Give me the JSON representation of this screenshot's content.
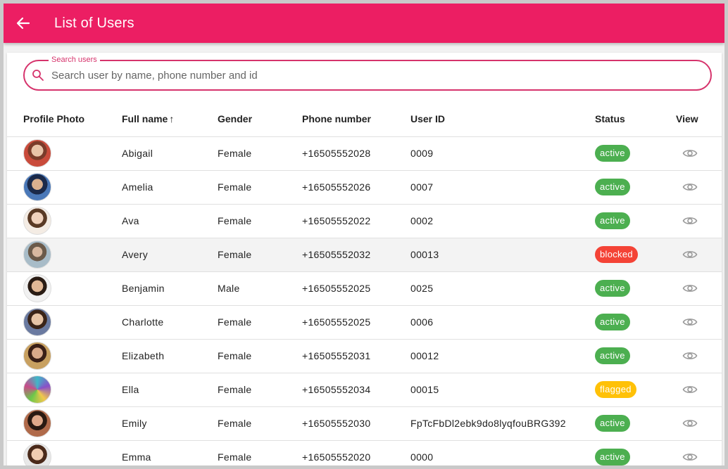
{
  "appbar": {
    "title": "List of Users",
    "back_icon": "arrow-left-icon",
    "color": "#ec1e63"
  },
  "search": {
    "label": "Search users",
    "placeholder": "Search user by name, phone number and id",
    "value": "",
    "icon": "search-icon"
  },
  "table": {
    "columns": [
      "Profile Photo",
      "Full name",
      "Gender",
      "Phone number",
      "User ID",
      "Status",
      "View"
    ],
    "sort": {
      "column": "Full name",
      "direction": "ascending",
      "icon": "arrow-up-icon"
    },
    "rows": [
      {
        "name": "Abigail",
        "gender": "Female",
        "phone": "+16505552028",
        "id": "0009",
        "status": "active"
      },
      {
        "name": "Amelia",
        "gender": "Female",
        "phone": "+16505552026",
        "id": "0007",
        "status": "active"
      },
      {
        "name": "Ava",
        "gender": "Female",
        "phone": "+16505552022",
        "id": "0002",
        "status": "active"
      },
      {
        "name": "Avery",
        "gender": "Female",
        "phone": "+16505552032",
        "id": "00013",
        "status": "blocked"
      },
      {
        "name": "Benjamin",
        "gender": "Male",
        "phone": "+16505552025",
        "id": "0025",
        "status": "active"
      },
      {
        "name": "Charlotte",
        "gender": "Female",
        "phone": "+16505552025",
        "id": "0006",
        "status": "active"
      },
      {
        "name": "Elizabeth",
        "gender": "Female",
        "phone": "+16505552031",
        "id": "00012",
        "status": "active"
      },
      {
        "name": "Ella",
        "gender": "Female",
        "phone": "+16505552034",
        "id": "00015",
        "status": "flagged"
      },
      {
        "name": "Emily",
        "gender": "Female",
        "phone": "+16505552030",
        "id": "FpTcFbDl2ebk9do8lyqfouBRG392",
        "status": "active"
      },
      {
        "name": "Emma",
        "gender": "Female",
        "phone": "+16505552020",
        "id": "0000",
        "status": "active"
      }
    ]
  },
  "status_colors": {
    "active": "#4caf50",
    "blocked": "#f44336",
    "flagged": "#ffc107"
  },
  "view_icon": "eye-icon"
}
